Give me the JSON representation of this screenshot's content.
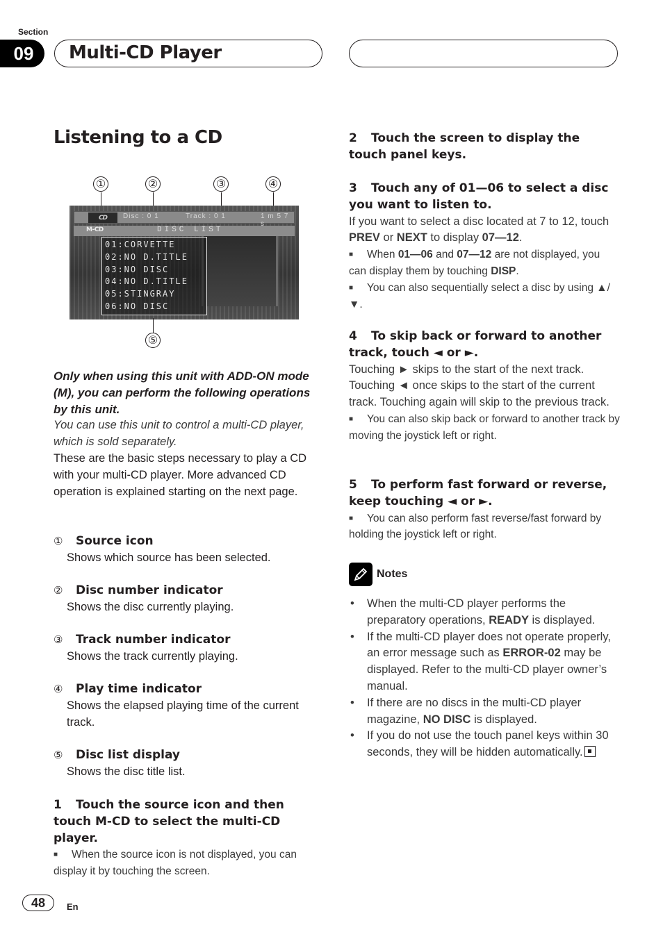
{
  "header": {
    "section_label": "Section",
    "section_number": "09",
    "title": "Multi-CD Player"
  },
  "page_heading": "Listening to a CD",
  "figure": {
    "callouts": [
      "①",
      "②",
      "③",
      "④",
      "⑤"
    ],
    "screen": {
      "source_icon": "CD",
      "disc": "Disc : 0 1",
      "track": "Track : 0 1",
      "time": "1 m 5 7 s",
      "mode": "M-CD",
      "list_title": "DISC LIST",
      "disc_list": [
        "01:CORVETTE",
        "02:NO D.TITLE",
        "03:NO DISC",
        "04:NO D.TITLE",
        "05:STINGRAY",
        "06:NO DISC"
      ]
    }
  },
  "intro": {
    "bold_italic": "Only when using this unit with ADD-ON mode (M), you can perform the following operations by this unit.",
    "italic": "You can use this unit to control a multi-CD player, which is sold separately.",
    "body": "These are the basic steps necessary to play a CD with your multi-CD player. More advanced CD operation is explained starting on the next page."
  },
  "legend": [
    {
      "num": "①",
      "title": "Source icon",
      "desc": "Shows which source has been selected."
    },
    {
      "num": "②",
      "title": "Disc number indicator",
      "desc": "Shows the disc currently playing."
    },
    {
      "num": "③",
      "title": "Track number indicator",
      "desc": "Shows the track currently playing."
    },
    {
      "num": "④",
      "title": "Play time indicator",
      "desc": "Shows the elapsed playing time of the current track."
    },
    {
      "num": "⑤",
      "title": "Disc list display",
      "desc": "Shows the disc title list."
    }
  ],
  "steps": {
    "s1": {
      "num": "1",
      "title": "Touch the source icon and then touch M-CD to select the multi-CD player.",
      "bullet": "When the source icon is not displayed, you can display it by touching the screen."
    },
    "s2": {
      "num": "2",
      "title": "Touch the screen to display the touch panel keys."
    },
    "s3": {
      "num": "3",
      "title": "Touch any of 01—06 to select a disc you want to listen to.",
      "body_pre": "If you want to select a disc located at 7 to 12, touch ",
      "prev": "PREV",
      "or": " or ",
      "next": "NEXT",
      "to_display": " to display ",
      "range2": "07—12",
      "period": ".",
      "b1_pre": "When ",
      "b1_r1": "01—06",
      "b1_and": " and ",
      "b1_r2": "07—12",
      "b1_mid": " are not displayed, you can display them by touching ",
      "b1_disp": "DISP",
      "b1_end": ".",
      "b2": "You can also sequentially select a disc by using ▲/▼."
    },
    "s4": {
      "num": "4",
      "title": "To skip back or forward to another track, touch ◄ or ►.",
      "body": "Touching ► skips to the start of the next track. Touching ◄ once skips to the start of the current track. Touching again will skip to the previous track.",
      "bullet": "You can also skip back or forward to another track by moving the joystick left or right."
    },
    "s5": {
      "num": "5",
      "title": "To perform fast forward or reverse, keep touching ◄ or ►.",
      "bullet": "You can also perform fast reverse/fast forward by holding the joystick left or right."
    }
  },
  "notes": {
    "heading": "Notes",
    "n1_pre": "When the multi-CD player performs the preparatory operations, ",
    "n1_b": "READY",
    "n1_post": " is displayed.",
    "n2_pre": "If the multi-CD player does not operate properly, an error message such as ",
    "n2_b": "ERROR-02",
    "n2_post": " may be displayed. Refer to the multi-CD player owner’s manual.",
    "n3_pre": "If there are no discs in the multi-CD player magazine, ",
    "n3_b": "NO DISC",
    "n3_post": " is displayed.",
    "n4": "If you do not use the touch panel keys within 30 seconds, they will be hidden automatically."
  },
  "footer": {
    "page_number": "48",
    "language": "En"
  }
}
